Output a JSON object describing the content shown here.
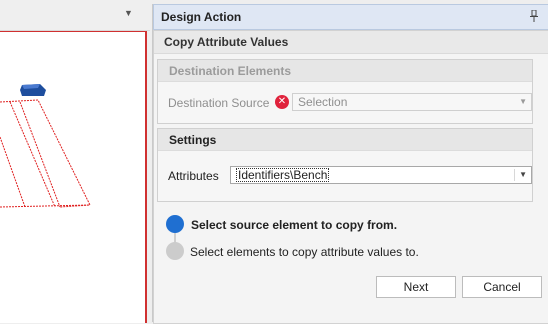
{
  "panel": {
    "title": "Design Action",
    "subtitle": "Copy Attribute Values"
  },
  "destination": {
    "title": "Destination Elements",
    "source_label": "Destination Source",
    "source_value": "Selection"
  },
  "settings": {
    "title": "Settings",
    "attributes_label": "Attributes",
    "attributes_value": "Identifiers\\Bench"
  },
  "steps": [
    {
      "label": "Select source element to copy from.",
      "state": "active"
    },
    {
      "label": "Select elements to copy attribute values to.",
      "state": "pending"
    }
  ],
  "buttons": {
    "next": "Next",
    "cancel": "Cancel"
  },
  "colors": {
    "accent": "#1f6fd1",
    "error": "#e0223c",
    "viewport_border": "#d03030",
    "header_bg": "#dfe7f4"
  },
  "icons": {
    "pin": "pin-icon",
    "error": "error-icon",
    "dropdown": "chevron-down-icon"
  }
}
